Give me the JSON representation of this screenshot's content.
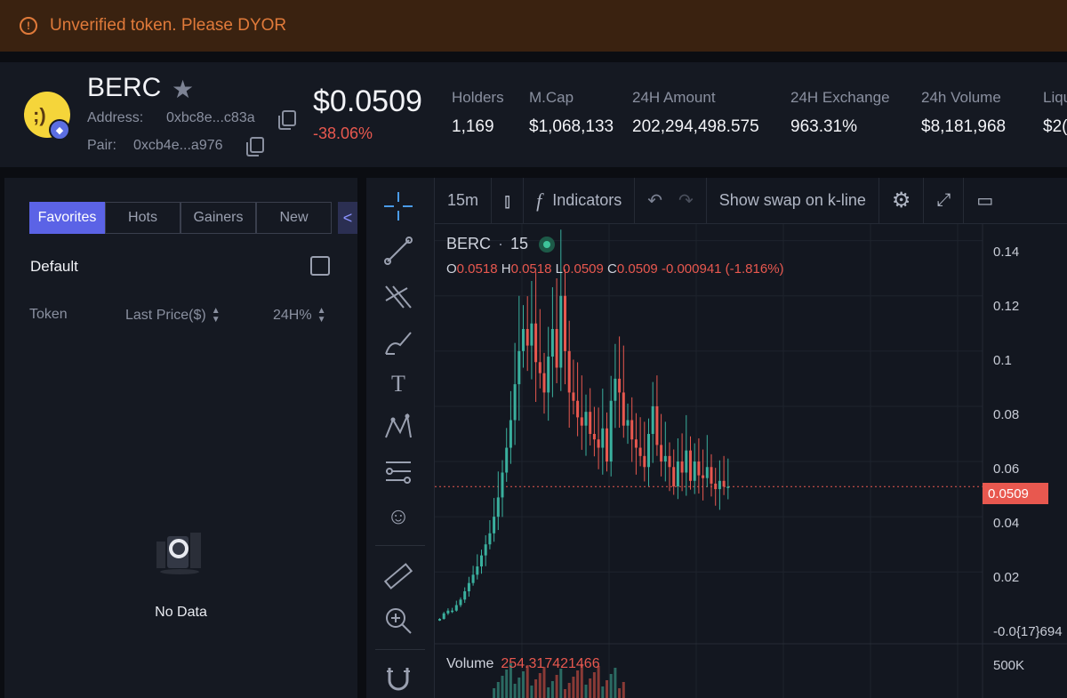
{
  "banner": {
    "icon": "!",
    "text": "Unverified token. Please DYOR"
  },
  "token": {
    "name": "BERC",
    "address_label": "Address:",
    "address": "0xbc8e...c83a",
    "pair_label": "Pair:",
    "pair": "0xcb4e...a976",
    "price": "$0.0509",
    "change": "-38.06%"
  },
  "stats": [
    {
      "label": "Holders",
      "value": "1,169"
    },
    {
      "label": "M.Cap",
      "value": "$1,068,133"
    },
    {
      "label": "24H Amount",
      "value": "202,294,498.575"
    },
    {
      "label": "24H Exchange",
      "value": "963.31%"
    },
    {
      "label": "24h Volume",
      "value": "$8,181,968"
    },
    {
      "label": "Liqu",
      "value": "$2("
    }
  ],
  "watchlist": {
    "tabs": [
      "Favorites",
      "Hots",
      "Gainers",
      "New"
    ],
    "active_tab": "Favorites",
    "collapse_icon": "<",
    "group": "Default",
    "columns": [
      "Token",
      "Last Price($)",
      "24H%"
    ],
    "empty_text": "No Data"
  },
  "chart_toolbar": {
    "interval": "15m",
    "indicators": "Indicators",
    "fx": "f",
    "swap_toggle": "Show swap on k-line"
  },
  "chart_legend": {
    "symbol": "BERC",
    "interval": "15",
    "o_label": "O",
    "o": "0.0518",
    "h_label": "H",
    "h": "0.0518",
    "l_label": "L",
    "l": "0.0509",
    "c_label": "C",
    "c": "0.0509",
    "change": "-0.000941 (-1.816%)",
    "volume_label": "Volume",
    "volume": "254.317421466"
  },
  "chart_data": {
    "type": "candlestick",
    "symbol": "BERC",
    "interval": "15",
    "y_axis_ticks": [
      "0.14",
      "0.12",
      "0.1",
      "0.08",
      "0.06",
      "0.04",
      "0.02",
      "-0.0{17}694"
    ],
    "ylim": [
      -0.006,
      0.146
    ],
    "current_price": "0.0509",
    "volume_axis_tick": "500K",
    "close_series": [
      0.003,
      0.005,
      0.006,
      0.006,
      0.008,
      0.01,
      0.013,
      0.016,
      0.019,
      0.022,
      0.026,
      0.03,
      0.034,
      0.04,
      0.047,
      0.056,
      0.065,
      0.075,
      0.088,
      0.1,
      0.108,
      0.102,
      0.11,
      0.096,
      0.092,
      0.085,
      0.098,
      0.108,
      0.094,
      0.12,
      0.1,
      0.085,
      0.082,
      0.076,
      0.073,
      0.078,
      0.07,
      0.068,
      0.065,
      0.072,
      0.06,
      0.082,
      0.09,
      0.085,
      0.073,
      0.075,
      0.068,
      0.065,
      0.062,
      0.058,
      0.07,
      0.08,
      0.066,
      0.06,
      0.062,
      0.058,
      0.051,
      0.06,
      0.056,
      0.064,
      0.053,
      0.06,
      0.055,
      0.054,
      0.058,
      0.052,
      0.05,
      0.053,
      0.0509,
      0.0509
    ]
  }
}
